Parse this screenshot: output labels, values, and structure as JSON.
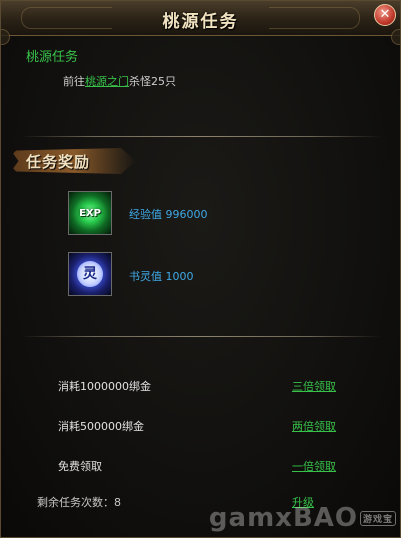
{
  "window": {
    "title": "桃源任务",
    "close_symbol": "✕"
  },
  "quest": {
    "name": "桃源任务",
    "desc_prefix": "前往",
    "desc_link": "桃源之门",
    "desc_suffix": "杀怪25只"
  },
  "rewards": {
    "header": "任务奖励",
    "items": [
      {
        "icon": "exp-icon",
        "icon_text": "EXP",
        "label": "经验值",
        "value": "996000"
      },
      {
        "icon": "shuling-icon",
        "icon_text": "灵",
        "label": "书灵值",
        "value": "1000"
      }
    ]
  },
  "claim_options": [
    {
      "cost": "消耗1000000绑金",
      "action": "三倍领取"
    },
    {
      "cost": "消耗500000绑金",
      "action": "两倍领取"
    },
    {
      "cost": "免费领取",
      "action": "一倍领取"
    }
  ],
  "remaining": {
    "label": "剩余任务次数：",
    "value": "8",
    "action": "升级"
  },
  "watermark": {
    "text": "gamxBAO",
    "tag": "游戏宝"
  }
}
